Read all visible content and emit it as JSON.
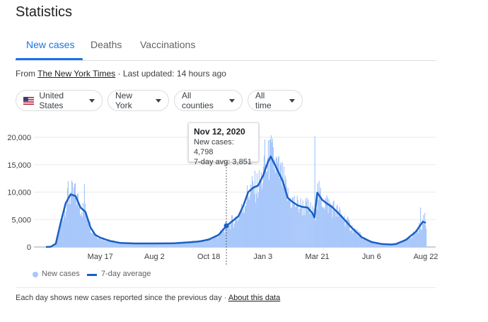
{
  "title": "Statistics",
  "tabs": [
    {
      "label": "New cases",
      "active": true
    },
    {
      "label": "Deaths",
      "active": false
    },
    {
      "label": "Vaccinations",
      "active": false
    }
  ],
  "source": {
    "prefix": "From ",
    "link": "The New York Times",
    "updated": " · Last updated: 14 hours ago"
  },
  "filters": [
    {
      "label": "United States",
      "icon": "us-flag-icon"
    },
    {
      "label": "New York"
    },
    {
      "label": "All counties"
    },
    {
      "label": "All time"
    }
  ],
  "tooltip": {
    "date": "Nov 12, 2020",
    "new_cases": "New cases: 4,798",
    "avg": "7-day avg: 3,851"
  },
  "legend": {
    "new_cases": "New cases",
    "avg": "7-day average"
  },
  "footer": {
    "text": "Each day shows new cases reported since the previous day",
    "separator": " · ",
    "link": "About this data"
  },
  "colors": {
    "accent": "#1a73e8",
    "bars": "#a8c7fa",
    "line": "#1a5fc4"
  },
  "chart_data": {
    "type": "area",
    "x_ticks": [
      "May 17",
      "Aug 2",
      "Oct 18",
      "Jan 3",
      "Mar 21",
      "Jun 6",
      "Aug 22"
    ],
    "y_ticks": [
      "0",
      "5,000",
      "10,000",
      "15,000",
      "20,000"
    ],
    "ylim": [
      0,
      20000
    ],
    "series": [
      {
        "name": "7-day average",
        "points": [
          [
            "2020-03-01",
            0
          ],
          [
            "2020-03-08",
            50
          ],
          [
            "2020-03-15",
            600
          ],
          [
            "2020-03-22",
            4500
          ],
          [
            "2020-03-29",
            8000
          ],
          [
            "2020-04-05",
            9600
          ],
          [
            "2020-04-12",
            9300
          ],
          [
            "2020-04-19",
            7200
          ],
          [
            "2020-04-26",
            6400
          ],
          [
            "2020-05-03",
            3600
          ],
          [
            "2020-05-10",
            2200
          ],
          [
            "2020-05-17",
            1700
          ],
          [
            "2020-05-31",
            1100
          ],
          [
            "2020-06-14",
            750
          ],
          [
            "2020-07-05",
            650
          ],
          [
            "2020-08-02",
            650
          ],
          [
            "2020-08-30",
            680
          ],
          [
            "2020-09-20",
            850
          ],
          [
            "2020-10-04",
            1000
          ],
          [
            "2020-10-18",
            1350
          ],
          [
            "2020-11-01",
            2200
          ],
          [
            "2020-11-12",
            3851
          ],
          [
            "2020-11-29",
            5600
          ],
          [
            "2020-12-06",
            7500
          ],
          [
            "2020-12-13",
            10000
          ],
          [
            "2020-12-20",
            10800
          ],
          [
            "2020-12-27",
            11200
          ],
          [
            "2021-01-03",
            13000
          ],
          [
            "2021-01-10",
            15500
          ],
          [
            "2021-01-14",
            16500
          ],
          [
            "2021-01-21",
            14700
          ],
          [
            "2021-01-31",
            12000
          ],
          [
            "2021-02-07",
            9000
          ],
          [
            "2021-02-14",
            8200
          ],
          [
            "2021-02-21",
            7600
          ],
          [
            "2021-02-28",
            7300
          ],
          [
            "2021-03-07",
            7200
          ],
          [
            "2021-03-14",
            6200
          ],
          [
            "2021-03-17",
            5400
          ],
          [
            "2021-03-21",
            9900
          ],
          [
            "2021-03-28",
            8600
          ],
          [
            "2021-04-04",
            7900
          ],
          [
            "2021-04-11",
            7300
          ],
          [
            "2021-04-25",
            5500
          ],
          [
            "2021-05-09",
            3500
          ],
          [
            "2021-05-23",
            1800
          ],
          [
            "2021-06-06",
            900
          ],
          [
            "2021-06-20",
            550
          ],
          [
            "2021-07-04",
            450
          ],
          [
            "2021-07-11",
            550
          ],
          [
            "2021-07-25",
            1300
          ],
          [
            "2021-08-08",
            2800
          ],
          [
            "2021-08-15",
            4100
          ],
          [
            "2021-08-18",
            4600
          ],
          [
            "2021-08-22",
            4400
          ]
        ]
      }
    ],
    "spikes": [
      [
        "2020-04-01",
        12000
      ],
      [
        "2020-04-10",
        11500
      ],
      [
        "2020-04-24",
        11500
      ],
      [
        "2021-01-05",
        19600
      ],
      [
        "2021-01-12",
        19500
      ],
      [
        "2021-03-17",
        20200
      ],
      [
        "2021-08-14",
        7200
      ],
      [
        "2021-08-20",
        6200
      ]
    ],
    "highlight": {
      "date": "2020-11-12",
      "new_cases": 4798,
      "avg": 3851
    }
  }
}
